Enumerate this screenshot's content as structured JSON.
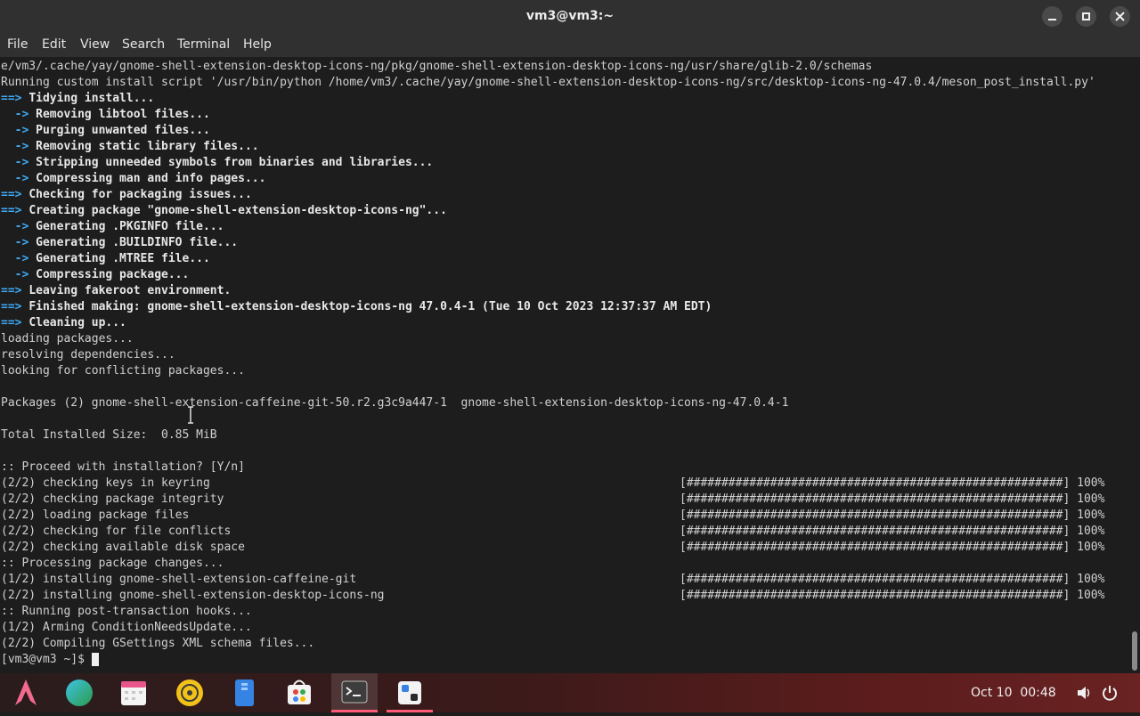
{
  "window": {
    "title": "vm3@vm3:~"
  },
  "menu": [
    "File",
    "Edit",
    "View",
    "Search",
    "Terminal",
    "Help"
  ],
  "terminal": {
    "lines": [
      {
        "t": "plain",
        "text": "e/vm3/.cache/yay/gnome-shell-extension-desktop-icons-ng/pkg/gnome-shell-extension-desktop-icons-ng/usr/share/glib-2.0/schemas"
      },
      {
        "t": "plain",
        "text": "Running custom install script '/usr/bin/python /home/vm3/.cache/yay/gnome-shell-extension-desktop-icons-ng/src/desktop-icons-ng-47.0.4/meson_post_install.py'"
      },
      {
        "t": "main",
        "text": "Tidying install..."
      },
      {
        "t": "sub",
        "text": "Removing libtool files..."
      },
      {
        "t": "sub",
        "text": "Purging unwanted files..."
      },
      {
        "t": "sub",
        "text": "Removing static library files..."
      },
      {
        "t": "sub",
        "text": "Stripping unneeded symbols from binaries and libraries..."
      },
      {
        "t": "sub",
        "text": "Compressing man and info pages..."
      },
      {
        "t": "main",
        "text": "Checking for packaging issues..."
      },
      {
        "t": "main",
        "text": "Creating package \"gnome-shell-extension-desktop-icons-ng\"..."
      },
      {
        "t": "sub",
        "text": "Generating .PKGINFO file..."
      },
      {
        "t": "sub",
        "text": "Generating .BUILDINFO file..."
      },
      {
        "t": "sub",
        "text": "Generating .MTREE file..."
      },
      {
        "t": "sub",
        "text": "Compressing package..."
      },
      {
        "t": "main",
        "text": "Leaving fakeroot environment."
      },
      {
        "t": "main",
        "text": "Finished making: gnome-shell-extension-desktop-icons-ng 47.0.4-1 (Tue 10 Oct 2023 12:37:37 AM EDT)"
      },
      {
        "t": "main",
        "text": "Cleaning up..."
      },
      {
        "t": "plain",
        "text": "loading packages..."
      },
      {
        "t": "plain",
        "text": "resolving dependencies..."
      },
      {
        "t": "plain",
        "text": "looking for conflicting packages..."
      },
      {
        "t": "plain",
        "text": ""
      },
      {
        "t": "plain",
        "text": "Packages (2) gnome-shell-extension-caffeine-git-50.r2.g3c9a447-1  gnome-shell-extension-desktop-icons-ng-47.0.4-1"
      },
      {
        "t": "plain",
        "text": ""
      },
      {
        "t": "plain",
        "text": "Total Installed Size:  0.85 MiB"
      },
      {
        "t": "plain",
        "text": ""
      },
      {
        "t": "plain",
        "text": ":: Proceed with installation? [Y/n]"
      },
      {
        "t": "prog",
        "text": "(2/2) checking keys in keyring",
        "bar": "[######################################################] 100%"
      },
      {
        "t": "prog",
        "text": "(2/2) checking package integrity",
        "bar": "[######################################################] 100%"
      },
      {
        "t": "prog",
        "text": "(2/2) loading package files",
        "bar": "[######################################################] 100%"
      },
      {
        "t": "prog",
        "text": "(2/2) checking for file conflicts",
        "bar": "[######################################################] 100%"
      },
      {
        "t": "prog",
        "text": "(2/2) checking available disk space",
        "bar": "[######################################################] 100%"
      },
      {
        "t": "plain",
        "text": ":: Processing package changes..."
      },
      {
        "t": "prog",
        "text": "(1/2) installing gnome-shell-extension-caffeine-git",
        "bar": "[######################################################] 100%"
      },
      {
        "t": "prog",
        "text": "(2/2) installing gnome-shell-extension-desktop-icons-ng",
        "bar": "[######################################################] 100%"
      },
      {
        "t": "plain",
        "text": ":: Running post-transaction hooks..."
      },
      {
        "t": "plain",
        "text": "(1/2) Arming ConditionNeedsUpdate..."
      },
      {
        "t": "plain",
        "text": "(2/2) Compiling GSettings XML schema files..."
      }
    ],
    "prompt": "[vm3@vm3 ~]$ "
  },
  "taskbar": {
    "apps": [
      {
        "name": "archlinux-logo-icon"
      },
      {
        "name": "browser-globe-icon"
      },
      {
        "name": "calendar-icon"
      },
      {
        "name": "music-disc-icon"
      },
      {
        "name": "file-manager-icon"
      },
      {
        "name": "software-store-icon"
      },
      {
        "name": "terminal-icon",
        "active": true
      },
      {
        "name": "extensions-icon",
        "indicator": true
      }
    ],
    "clock": "Oct 10  00:48",
    "accent": "#ff5a7a"
  }
}
